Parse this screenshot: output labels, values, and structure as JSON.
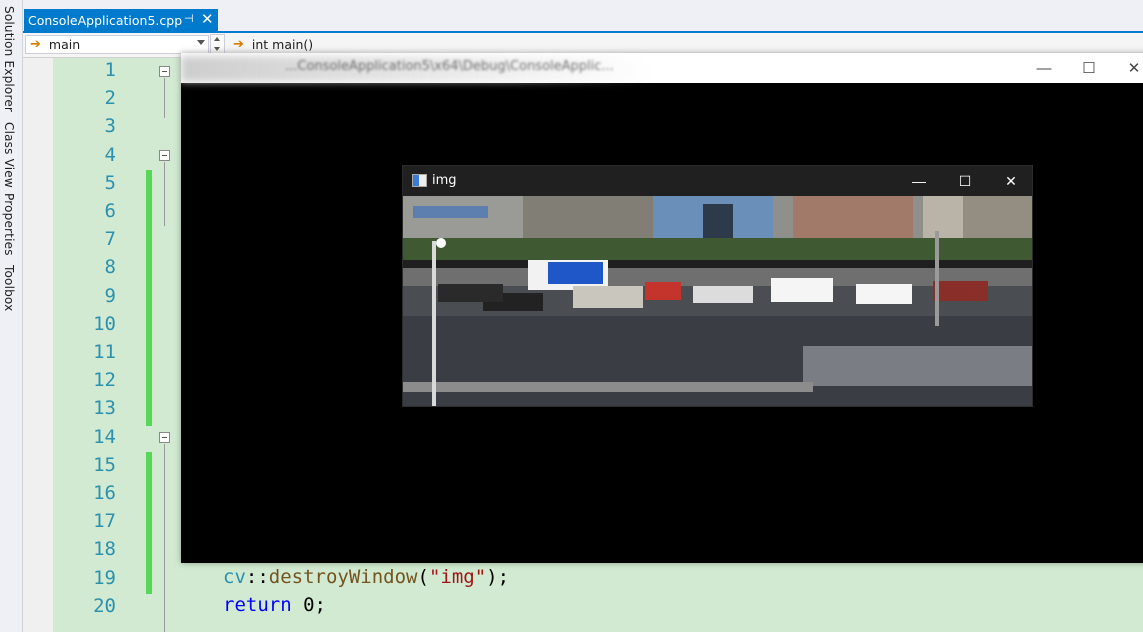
{
  "sidebar": {
    "items": [
      "Solution Explorer",
      "Class View",
      "Properties",
      "Toolbox"
    ]
  },
  "tab": {
    "label": "ConsoleApplication5.cpp",
    "pin": "⊣",
    "close": "✕"
  },
  "nav": {
    "scope": "main",
    "member": "int main()"
  },
  "editor": {
    "line_numbers": [
      "1",
      "2",
      "3",
      "4",
      "5",
      "6",
      "7",
      "8",
      "9",
      "10",
      "11",
      "12",
      "13",
      "14",
      "15",
      "16",
      "17",
      "18",
      "19",
      "20"
    ],
    "code": {
      "l19_ns": "cv",
      "l19_sep": "::",
      "l19_fn": "destroyWindow",
      "l19_p1": "(",
      "l19_str": "\"img\"",
      "l19_p2": ");",
      "l20_kw": "return",
      "l20_rest": " 0;"
    }
  },
  "console": {
    "path": "...ConsoleApplication5\\x64\\Debug\\ConsoleApplic...",
    "min": "—",
    "max": "☐",
    "close": "✕"
  },
  "img_window": {
    "title": "img",
    "min": "—",
    "max": "☐",
    "close": "✕"
  },
  "colors": {
    "accent": "#007acc",
    "change_bar": "#57d657",
    "code_bg": "#d1ead1"
  }
}
